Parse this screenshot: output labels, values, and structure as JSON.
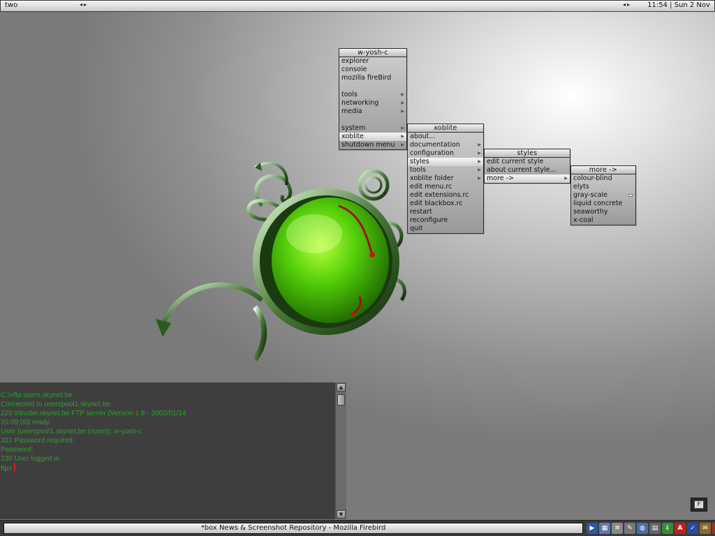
{
  "topbar": {
    "workspace": "two",
    "clock": "11:54 | Sun 2 Nov"
  },
  "menus": {
    "root": {
      "title": "w-yosh-c",
      "items": [
        "explorer",
        "console",
        "mozilla fireBird",
        "",
        "tools",
        "networking",
        "media",
        "",
        "system",
        "xoblite",
        "shutdown menu"
      ]
    },
    "xoblite": {
      "title": "xoblite",
      "items": [
        "about...",
        "documentation",
        "configuration",
        "styles",
        "tools",
        "xoblite folder",
        "edit menu.rc",
        "edit extensions.rc",
        "edit blackbox.rc",
        "restart",
        "reconfigure",
        "quit"
      ]
    },
    "styles": {
      "title": "styles",
      "items": [
        "edit current style",
        "about current style...",
        "more ->"
      ]
    },
    "more": {
      "title": "more ->",
      "items": [
        "colour-blind",
        "elyts",
        "gray-scale",
        "liquid concrete",
        "seaworthy",
        "x-coal"
      ]
    }
  },
  "terminal": {
    "lines": [
      "C:\\>ftp users.skynet.be",
      "Connected to userspool1.skynet.be.",
      "220 intruder.skynet.be FTP server (Version 1.8 - 2002/01/14",
      "20:09:00) ready.",
      "User (userspool1.skynet.be:(none)): w-yosh-c",
      "331 Password required.",
      "Password:",
      "230 User logged in.",
      "ftp>"
    ]
  },
  "desktop_button": {
    "label": "F"
  },
  "taskbar": {
    "task_title": "*box News & Screenshot Repository - Mozilla Firebird",
    "tray_icons": [
      {
        "icon": "media-player-icon",
        "color": "#2c5aa0"
      },
      {
        "icon": "network-icon",
        "color": "#5a7ab0"
      },
      {
        "icon": "settings-icon",
        "color": "#888888"
      },
      {
        "icon": "tool-icon",
        "color": "#777777"
      },
      {
        "icon": "globe-icon",
        "color": "#4a6fa5"
      },
      {
        "icon": "hardware-icon",
        "color": "#666666"
      },
      {
        "icon": "download-icon",
        "color": "#3a8a3a"
      },
      {
        "icon": "antivirus-icon",
        "color": "#c02020"
      },
      {
        "icon": "shield-icon",
        "color": "#2a4aa0"
      },
      {
        "icon": "mail-icon",
        "color": "#8a6a2a"
      },
      {
        "icon": "refresh-icon",
        "color": "#a03030"
      }
    ]
  }
}
